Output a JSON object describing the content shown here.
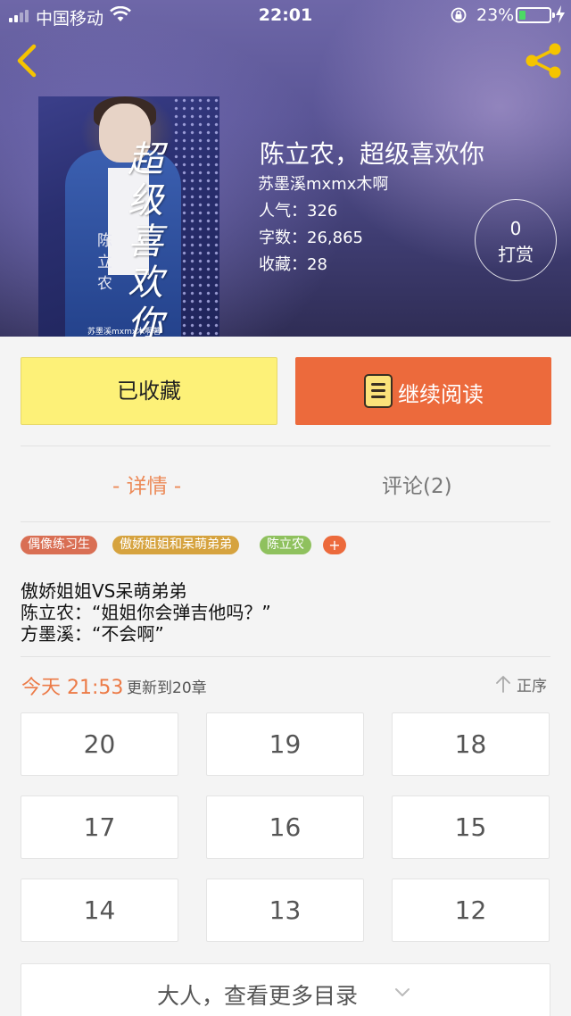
{
  "status_bar": {
    "carrier": "中国移动",
    "time": "22:01",
    "battery_percent": "23%",
    "battery_level": 0.23,
    "battery_color": "#4cd964"
  },
  "header": {
    "back_icon": "chevron-left-icon",
    "share_icon": "share-icon",
    "accent_color": "#f5c400"
  },
  "book": {
    "title": "陈立农，超级喜欢你",
    "author": "苏墨溪mxmx木啊",
    "stats": [
      {
        "label": "人气：",
        "value": "326"
      },
      {
        "label": "字数：",
        "value": "26,865"
      },
      {
        "label": "收藏：",
        "value": "28"
      }
    ],
    "reward": {
      "count": "0",
      "label": "打赏"
    },
    "cover_art": {
      "title": "超级喜欢你",
      "side": "陈立农",
      "footer": "苏墨溪mxmx木啊著"
    }
  },
  "actions": {
    "collected_label": "已收藏",
    "read_label": "继续阅读",
    "read_icon": "book-icon"
  },
  "tabs": {
    "detail": "- 详情 -",
    "comments": "评论(2)"
  },
  "tags": [
    {
      "label": "偶像练习生",
      "color": "#d96f54"
    },
    {
      "label": "傲娇姐姐和呆萌弟弟",
      "color": "#d6a33f"
    },
    {
      "label": "陈立农",
      "color": "#8fc15e"
    },
    {
      "label": "+",
      "color": "#ec6a3c"
    }
  ],
  "description": [
    "傲娇姐姐VS呆萌弟弟",
    "陈立农：“姐姐你会弹吉他吗？”",
    "方墨溪：“不会啊”"
  ],
  "update": {
    "time": "今天 21:53",
    "text": "更新到20章",
    "sort_label": "正序",
    "sort_icon": "arrow-up-icon"
  },
  "chapters": [
    "20",
    "19",
    "18",
    "17",
    "16",
    "15",
    "14",
    "13",
    "12"
  ],
  "more": {
    "label": "大人，查看更多目录",
    "icon": "chevron-down-icon"
  }
}
